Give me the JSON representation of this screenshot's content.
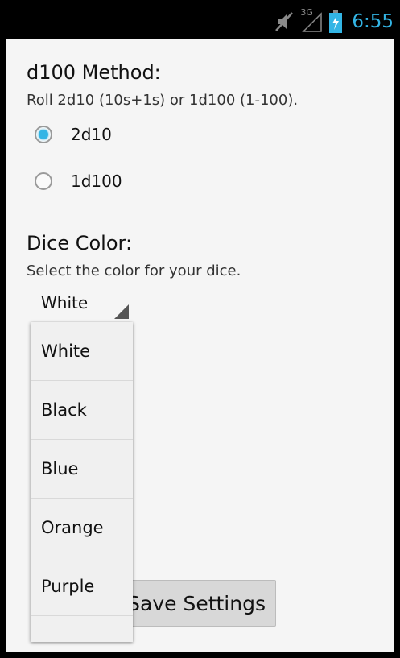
{
  "status_bar": {
    "network_label": "3G",
    "time": "6:55",
    "icons": [
      "mute-icon",
      "signal-icon",
      "battery-charging-icon"
    ],
    "accent_color": "#33b5e5"
  },
  "d100": {
    "title": "d100 Method:",
    "summary": "Roll 2d10 (10s+1s) or 1d100 (1-100).",
    "options": [
      {
        "label": "2d10",
        "checked": true
      },
      {
        "label": "1d100",
        "checked": false
      }
    ]
  },
  "dice_color": {
    "title": "Dice Color:",
    "summary": "Select the color for your dice.",
    "selected": "White",
    "options": [
      "White",
      "Black",
      "Blue",
      "Orange",
      "Purple"
    ]
  },
  "save_button": {
    "label": "Save Settings"
  }
}
